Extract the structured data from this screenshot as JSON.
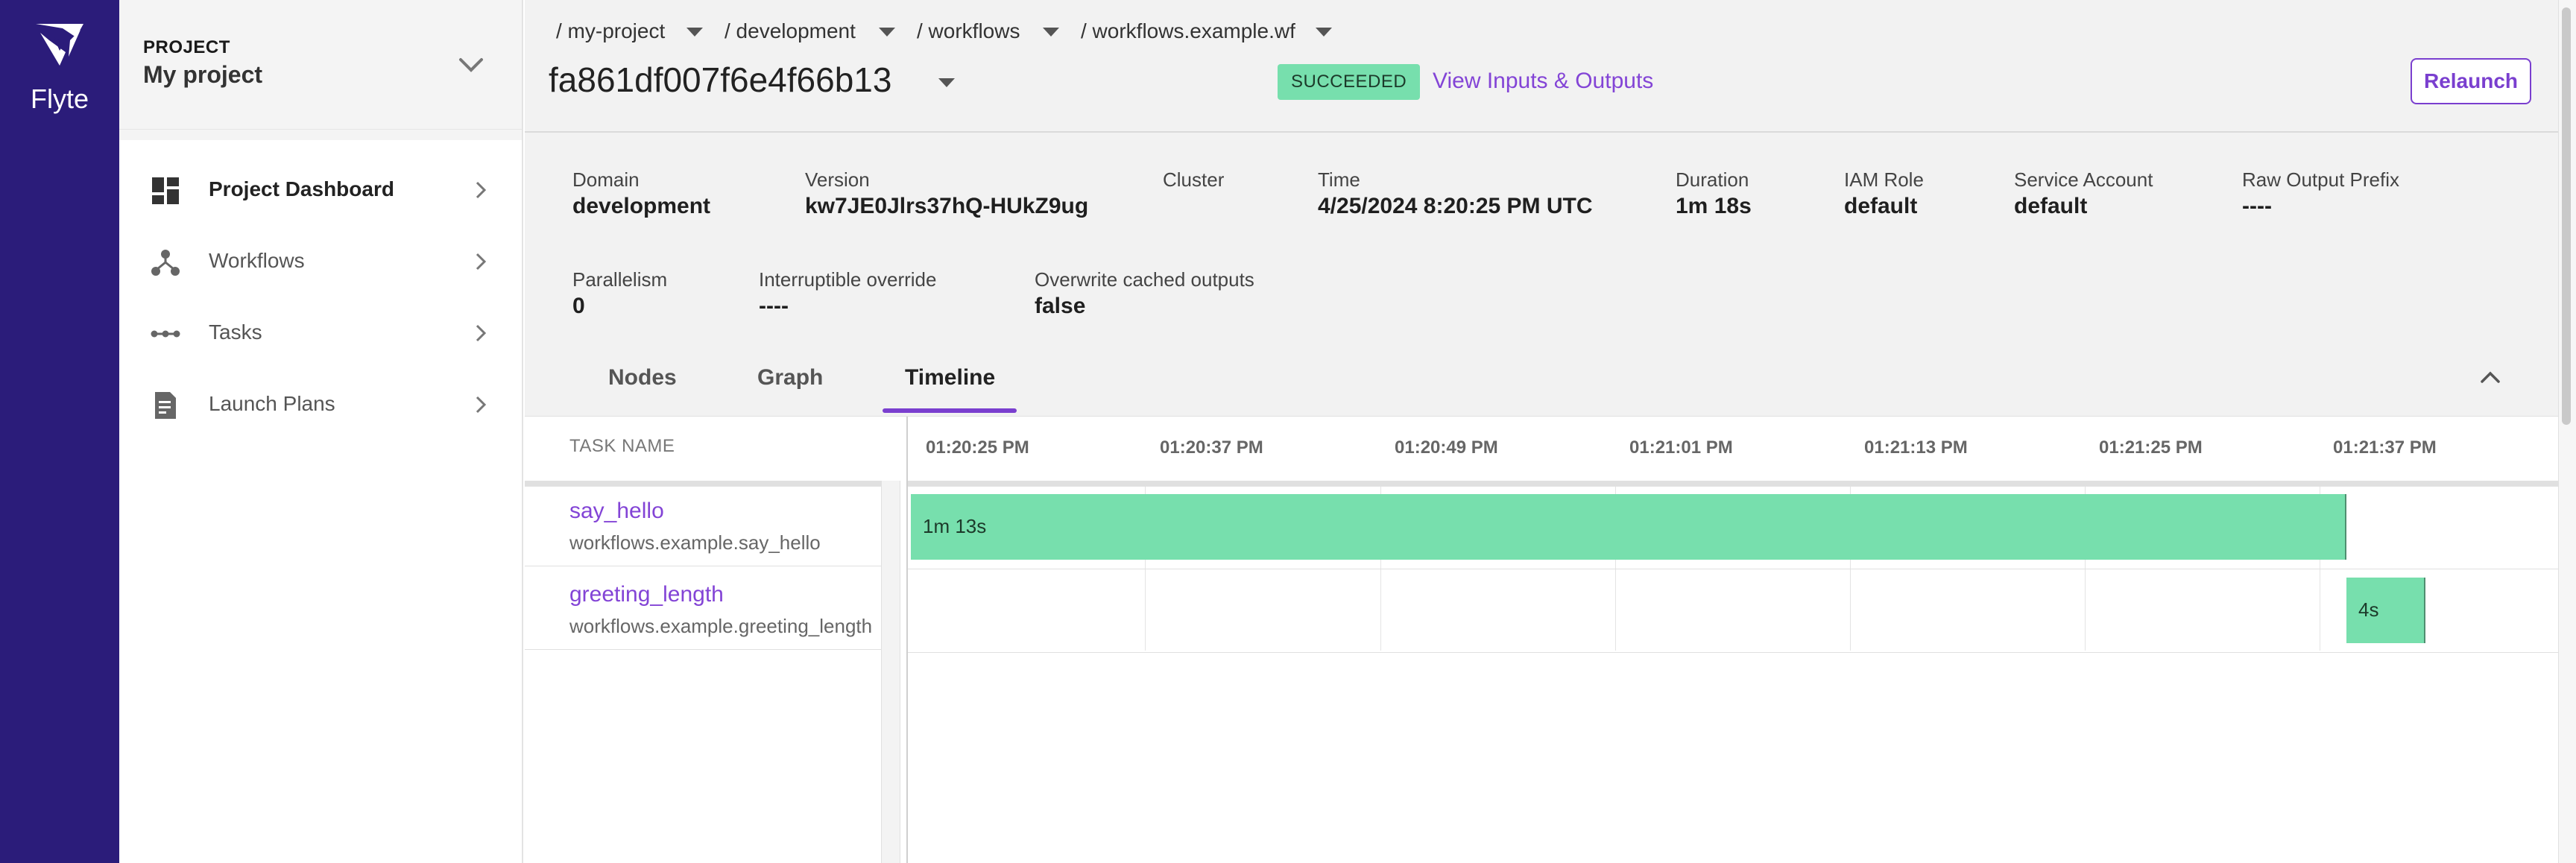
{
  "app": {
    "brand": "Flyte"
  },
  "project": {
    "kicker": "PROJECT",
    "name": "My project"
  },
  "nav": [
    {
      "label": "Project Dashboard",
      "icon": "dashboard-icon",
      "active": true
    },
    {
      "label": "Workflows",
      "icon": "workflow-icon",
      "active": false
    },
    {
      "label": "Tasks",
      "icon": "tasks-icon",
      "active": false
    },
    {
      "label": "Launch Plans",
      "icon": "launch-plan-icon",
      "active": false
    }
  ],
  "breadcrumb": [
    {
      "label": "/ my-project"
    },
    {
      "label": "/ development"
    },
    {
      "label": "/ workflows"
    },
    {
      "label": "/ workflows.example.wf"
    }
  ],
  "execution": {
    "id": "fa861df007f6e4f66b13",
    "status": "SUCCEEDED",
    "io_link": "View Inputs & Outputs",
    "relaunch": "Relaunch"
  },
  "metadata": [
    {
      "label": "Domain",
      "value": "development"
    },
    {
      "label": "Version",
      "value": "kw7JE0Jlrs37hQ-HUkZ9ug"
    },
    {
      "label": "Cluster",
      "value": ""
    },
    {
      "label": "Time",
      "value": "4/25/2024 8:20:25 PM UTC"
    },
    {
      "label": "Duration",
      "value": "1m 18s"
    },
    {
      "label": "IAM Role",
      "value": "default"
    },
    {
      "label": "Service Account",
      "value": "default"
    },
    {
      "label": "Raw Output Prefix",
      "value": "----"
    },
    {
      "label": "Parallelism",
      "value": "0"
    },
    {
      "label": "Interruptible override",
      "value": "----"
    },
    {
      "label": "Overwrite cached outputs",
      "value": "false"
    }
  ],
  "tabs": [
    {
      "label": "Nodes"
    },
    {
      "label": "Graph"
    },
    {
      "label": "Timeline",
      "active": true
    }
  ],
  "timeline": {
    "task_header": "TASK NAME",
    "ticks": [
      "01:20:25 PM",
      "01:20:37 PM",
      "01:20:49 PM",
      "01:21:01 PM",
      "01:21:13 PM",
      "01:21:25 PM",
      "01:21:37 PM"
    ],
    "tasks": [
      {
        "name": "say_hello",
        "path": "workflows.example.say_hello",
        "duration": "1m 13s"
      },
      {
        "name": "greeting_length",
        "path": "workflows.example.greeting_length",
        "duration": "4s"
      }
    ]
  },
  "colors": {
    "rail": "#2b1c7a",
    "accent": "#7a3fcf",
    "success": "#77dfad"
  }
}
